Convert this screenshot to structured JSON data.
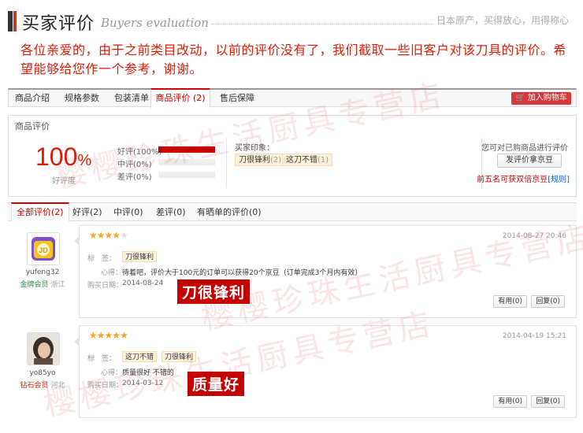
{
  "header": {
    "title": "买家评价",
    "subtitle_en": "Buyers evaluation",
    "slogan": "日本原产，买得放心，用得称心"
  },
  "notice": "各位亲爱的，由于之前类目改动，以前的评价没有了，我们截取一些旧客户对该刀具的评价。希望能够给您作一个参考，谢谢。",
  "tabs": [
    {
      "label": "商品介绍"
    },
    {
      "label": "规格参数"
    },
    {
      "label": "包装清单"
    },
    {
      "label": "商品评价 (2)"
    },
    {
      "label": "售后保障"
    }
  ],
  "cart_button": "加入购物车",
  "summary": {
    "title": "商品评价",
    "percent": "100",
    "percent_unit": "%",
    "percent_label": "好评度",
    "ratings": [
      {
        "label": "好评(100%)",
        "value": 1.0
      },
      {
        "label": "中评(0%)",
        "value": 0
      },
      {
        "label": "差评(0%)",
        "value": 0
      }
    ],
    "impression_title": "买家印象：",
    "impressions": [
      {
        "text": "刀很锋利",
        "count": "(2)"
      },
      {
        "text": "这刀不错",
        "count": "(1)"
      }
    ],
    "review_prompt": "您可对已购商品进行评价",
    "review_button": "发评价拿京豆",
    "review_note": "前五名可获双倍京豆",
    "review_note_link": "[规则]"
  },
  "filter_tabs": [
    {
      "label": "全部评价(2)"
    },
    {
      "label": "好评(2)"
    },
    {
      "label": "中评(0)"
    },
    {
      "label": "差评(0)"
    },
    {
      "label": "有晒单的评价(0)"
    }
  ],
  "reviews": [
    {
      "username": "yufeng32",
      "level": "金牌会员",
      "region": "浙江",
      "level_color": "#2e8b57",
      "stars": 4,
      "date": "2014-08-27 20:46",
      "tag_label": "标　签：",
      "tags": [
        "刀很锋利"
      ],
      "comment_label": "心得：",
      "comment": "待着吧，评价大于100元的订单可以获得20个京豆（订单完成3个月内有效）",
      "purchase_label": "购买日期：",
      "purchase_date": "2014-08-24",
      "big_label": "刀很锋利",
      "useful": "有用(0)",
      "reply": "回复(0)"
    },
    {
      "username": "yo85yo",
      "level": "钻石会员",
      "region": "河北",
      "level_color": "#d81e06",
      "stars": 5,
      "date": "2014-04-19 15:21",
      "tag_label": "标　签：",
      "tags": [
        "这刀不错",
        "刀很锋利"
      ],
      "comment_label": "心得：",
      "comment": "质量很好 不错的",
      "purchase_label": "购买日期：",
      "purchase_date": "2014-03-12",
      "big_label": "质量好",
      "useful": "有用(0)",
      "reply": "回复(0)"
    }
  ],
  "watermark": "樱樱珍珠生活厨具专营店"
}
